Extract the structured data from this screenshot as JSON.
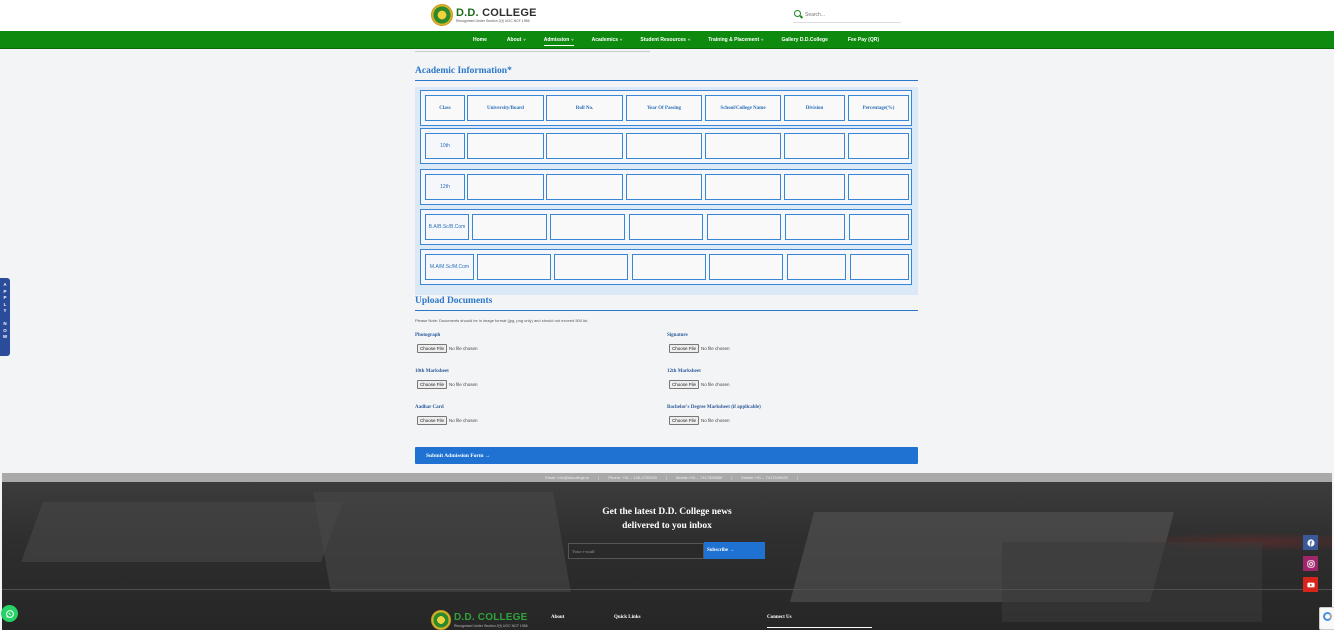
{
  "header": {
    "logo_title_main": "D.D.",
    "logo_title_rest": " COLLEGE",
    "logo_sub": "Recognised Under Section 2(f) UGC NCF 1956",
    "search_placeholder": "Search..."
  },
  "nav": {
    "items": [
      {
        "label": "Home",
        "caret": ""
      },
      {
        "label": "About",
        "caret": "˅"
      },
      {
        "label": "Admission",
        "caret": "˅"
      },
      {
        "label": "Academics",
        "caret": "˅"
      },
      {
        "label": "Student Resources",
        "caret": "˅"
      },
      {
        "label": "Training & Placement",
        "caret": "˅"
      },
      {
        "label": "Gallery D.D.College",
        "caret": ""
      },
      {
        "label": "Fee Pay (QR)",
        "caret": ""
      }
    ]
  },
  "apply_tab": "A\nP\nP\nL\nY\n\nN\nO\nW",
  "academic": {
    "title": "Academic Information*",
    "headers": [
      "Class",
      "University/Board",
      "Roll No.",
      "Year Of Passing",
      "School/College Name",
      "Division",
      "Percentage(%)"
    ],
    "rows": [
      "10th",
      "12th",
      "B.A/B.Sc/B.Com",
      "M.A/M.Sc/M.Com"
    ]
  },
  "upload": {
    "title": "Upload Documents",
    "note": "Please Note: Documents should be in image format (jpg, png only) and should not exceed 500 kb.",
    "button_label": "Choose File",
    "status": "No file chosen",
    "fields": [
      "Photograph",
      "Signature",
      "10th Marksheet",
      "12th Marksheet",
      "Aadhar Card",
      "Bachelor's Degree Marksheet (if applicable)"
    ]
  },
  "submit_label": "Submit Admission Form →",
  "contact_bar": [
    "Email: info@ddcollege.in",
    "Phone: +91 – 135-2750929",
    "Mobile:+91 – 7417555666",
    "Mobile:+91 – 7417949929"
  ],
  "newsletter": {
    "title_line1": "Get the latest D.D. College news",
    "title_line2": "delivered to you inbox",
    "email_placeholder": "Your e-mail",
    "subscribe_label": "Subscribe →"
  },
  "footer": {
    "col_about": "About",
    "col_quick": "Quick Links",
    "col_connect": "Connect Us"
  },
  "colors": {
    "nav_green": "#0e8a0e",
    "accent_blue": "#1f72d2",
    "facebook": "#3b5998",
    "instagram": "#a0266a",
    "youtube": "#d7251b",
    "whatsapp": "#25d366"
  },
  "icons": [
    "search-icon",
    "facebook-icon",
    "instagram-icon",
    "youtube-icon",
    "whatsapp-icon",
    "recaptcha-icon"
  ]
}
